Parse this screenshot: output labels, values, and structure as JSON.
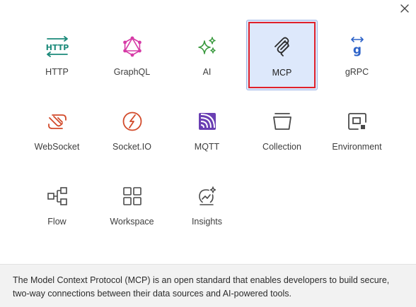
{
  "dialog": {
    "close_icon": "close-icon"
  },
  "tiles": [
    {
      "id": "http",
      "label": "HTTP",
      "icon": "http-icon",
      "color": "#1b8a7a",
      "selected": false
    },
    {
      "id": "graphql",
      "label": "GraphQL",
      "icon": "graphql-icon",
      "color": "#d63aa6",
      "selected": false
    },
    {
      "id": "ai",
      "label": "AI",
      "icon": "sparkles-icon",
      "color": "#3a9a3f",
      "selected": false
    },
    {
      "id": "mcp",
      "label": "MCP",
      "icon": "mcp-icon",
      "color": "#2b2b2b",
      "selected": true
    },
    {
      "id": "grpc",
      "label": "gRPC",
      "icon": "grpc-icon",
      "color": "#2d63c8",
      "selected": false
    },
    {
      "id": "websocket",
      "label": "WebSocket",
      "icon": "websocket-icon",
      "color": "#d24a2a",
      "selected": false
    },
    {
      "id": "socketio",
      "label": "Socket.IO",
      "icon": "socketio-icon",
      "color": "#d24a2a",
      "selected": false
    },
    {
      "id": "mqtt",
      "label": "MQTT",
      "icon": "mqtt-icon",
      "color": "#6a3fb3",
      "selected": false
    },
    {
      "id": "collection",
      "label": "Collection",
      "icon": "collection-icon",
      "color": "#4a4a4a",
      "selected": false
    },
    {
      "id": "environment",
      "label": "Environment",
      "icon": "environment-icon",
      "color": "#4a4a4a",
      "selected": false
    },
    {
      "id": "flow",
      "label": "Flow",
      "icon": "flow-icon",
      "color": "#4a4a4a",
      "selected": false
    },
    {
      "id": "workspace",
      "label": "Workspace",
      "icon": "workspace-icon",
      "color": "#4a4a4a",
      "selected": false
    },
    {
      "id": "insights",
      "label": "Insights",
      "icon": "insights-icon",
      "color": "#4a4a4a",
      "selected": false
    }
  ],
  "footer": {
    "description": "The Model Context Protocol (MCP) is an open standard that enables developers to build secure, two-way connections between their data sources and AI-powered tools."
  },
  "colors": {
    "selected_bg": "#dde8fb",
    "highlight": "#e0202a",
    "footer_bg": "#f2f2f2"
  }
}
